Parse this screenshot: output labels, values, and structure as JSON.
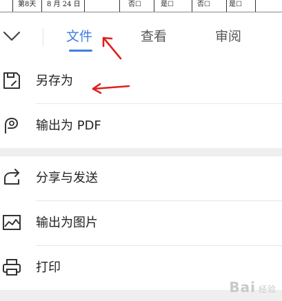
{
  "document_strip": {
    "cells": [
      "第8天",
      "8 月 24 日",
      "否☐",
      "是☐",
      "否☐",
      "是☐"
    ]
  },
  "tabs": [
    {
      "label": "文件",
      "active": true
    },
    {
      "label": "查看",
      "active": false
    },
    {
      "label": "审阅",
      "active": false
    }
  ],
  "menu": {
    "save_as": {
      "label": "另存为",
      "icon": "save-as-icon"
    },
    "export_pdf": {
      "label": "输出为 PDF",
      "icon": "pdf-export-icon"
    },
    "share_send": {
      "label": "分享与发送",
      "icon": "share-icon"
    },
    "export_image": {
      "label": "输出为图片",
      "icon": "image-icon"
    },
    "print": {
      "label": "打印",
      "icon": "printer-icon"
    }
  },
  "watermark": {
    "text": "Bai",
    "suffix": "经验"
  },
  "colors": {
    "accent": "#3f7de0",
    "annotation": "#e0201c",
    "gap": "#efefef"
  }
}
